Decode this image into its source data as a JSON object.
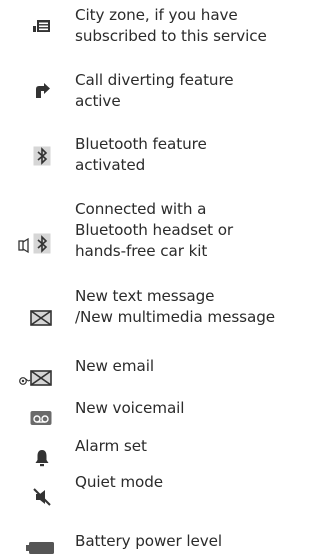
{
  "items": [
    {
      "icon": "city-zone-icon",
      "text": "City zone, if you have\nsubscribed to this service"
    },
    {
      "icon": "call-divert-icon",
      "text": "Call diverting feature\nactive"
    },
    {
      "icon": "bluetooth-icon",
      "text": "Bluetooth feature\nactivated"
    },
    {
      "icon": "bluetooth-headset-icon",
      "text": "Connected with a\nBluetooth headset or\nhands-free car kit"
    },
    {
      "icon": "envelope-icon",
      "text": "New text message\n/New multimedia message"
    },
    {
      "icon": "email-icon",
      "text": "New email"
    },
    {
      "icon": "voicemail-icon",
      "text": "New voicemail"
    },
    {
      "icon": "alarm-bell-icon",
      "text": "Alarm set"
    },
    {
      "icon": "quiet-mode-icon",
      "text": "Quiet mode"
    },
    {
      "icon": "battery-icon",
      "text": "Battery power level"
    }
  ]
}
